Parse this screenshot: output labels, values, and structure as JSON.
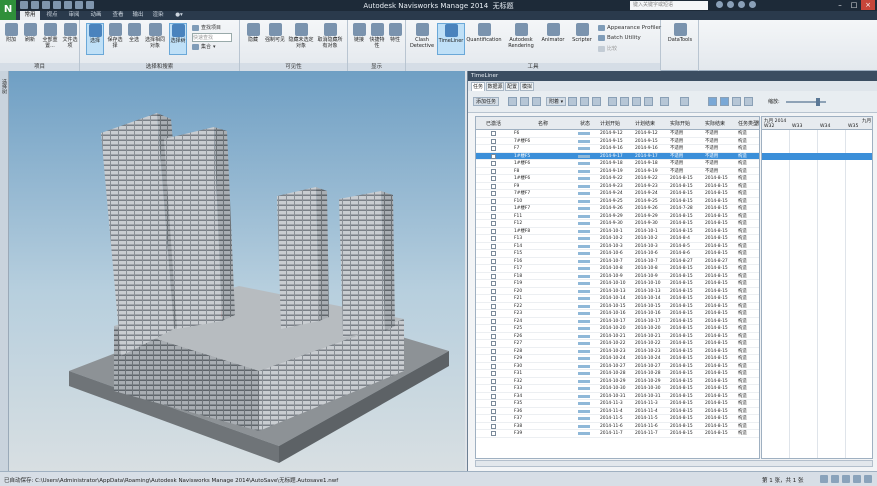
{
  "titlebar": {
    "app_title": "Autodesk Navisworks Manage 2014",
    "file_title": "无标题",
    "search_placeholder": "键入关键字或短语"
  },
  "ribbon_tabs": [
    "常用",
    "视点",
    "审阅",
    "动画",
    "查看",
    "输出",
    "渲染"
  ],
  "ribbon": {
    "project_group": {
      "label": "项目",
      "buttons": [
        "附加",
        "刷新",
        "全部重置...",
        "文件选项"
      ]
    },
    "select_group": {
      "label": "选择和搜索",
      "buttons": [
        "选择",
        "保存选择",
        "全选",
        "选择相同对象",
        "选择树"
      ],
      "small": [
        "查找项目",
        "快速查找",
        "集合"
      ]
    },
    "visibility_group": {
      "label": "可见性",
      "buttons": [
        "隐藏",
        "强制可见",
        "隐藏未选定对象",
        "取消隐藏所有对象"
      ]
    },
    "display_group": {
      "label": "显示",
      "buttons": [
        "链接",
        "快捷特性",
        "特性"
      ]
    },
    "tools_group": {
      "label": "工具",
      "buttons": [
        "Clash Detective",
        "TimeLiner",
        "Quantification",
        "Autodesk Rendering",
        "Animator",
        "Scripter"
      ],
      "small": [
        "Appearance Profiler",
        "Batch Utility",
        "比较"
      ]
    },
    "datatools_label": "DataTools"
  },
  "sidebar_label": "选择树",
  "timeliner": {
    "title": "TimeLiner",
    "tabs": [
      "任务",
      "数据源",
      "配置",
      "模拟"
    ],
    "toolbar": {
      "add_task": "添加任务",
      "attach": "附着",
      "zoom_label": "缩放:"
    },
    "columns": [
      "已激活",
      "名称",
      "状态",
      "计划开始",
      "计划结束",
      "实际开始",
      "实际结束",
      "任务类型",
      "附"
    ],
    "gantt": {
      "month": "九月 2014",
      "month_next": "九月",
      "weeks": [
        "W32",
        "W33",
        "W34",
        "W35"
      ]
    },
    "selected_row": 3,
    "tasks": [
      {
        "name": "F6",
        "ps": "2014-9-12",
        "pe": "2014-9-12",
        "as": "不适用",
        "ae": "不适用",
        "type": "构造"
      },
      {
        "name": "7#楼F6",
        "ps": "2014-9-15",
        "pe": "2014-9-15",
        "as": "不适用",
        "ae": "不适用",
        "type": "构造"
      },
      {
        "name": "F7",
        "ps": "2014-9-16",
        "pe": "2014-9-16",
        "as": "不适用",
        "ae": "不适用",
        "type": "构造"
      },
      {
        "name": "1#楼F5",
        "ps": "2014-9-17",
        "pe": "2014-9-17",
        "as": "不适用",
        "ae": "不适用",
        "type": "构造"
      },
      {
        "name": "1#楼F6",
        "ps": "2014-9-18",
        "pe": "2014-9-18",
        "as": "不适用",
        "ae": "不适用",
        "type": "构造"
      },
      {
        "name": "F8",
        "ps": "2014-9-19",
        "pe": "2014-9-19",
        "as": "不适用",
        "ae": "不适用",
        "type": "构造"
      },
      {
        "name": "1#楼F6",
        "ps": "2014-9-22",
        "pe": "2014-9-22",
        "as": "2014-8-15",
        "ae": "2014-8-15",
        "type": "构造"
      },
      {
        "name": "F9",
        "ps": "2014-9-23",
        "pe": "2014-9-23",
        "as": "2014-8-15",
        "ae": "2014-8-15",
        "type": "构造"
      },
      {
        "name": "7#楼F7",
        "ps": "2014-9-24",
        "pe": "2014-9-24",
        "as": "2014-8-15",
        "ae": "2014-8-15",
        "type": "构造"
      },
      {
        "name": "F10",
        "ps": "2014-9-25",
        "pe": "2014-9-25",
        "as": "2014-8-15",
        "ae": "2014-8-15",
        "type": "构造"
      },
      {
        "name": "1#楼F7",
        "ps": "2014-9-26",
        "pe": "2014-9-26",
        "as": "2014-7-28",
        "ae": "2014-8-15",
        "type": "构造"
      },
      {
        "name": "F11",
        "ps": "2014-9-29",
        "pe": "2014-9-29",
        "as": "2014-8-15",
        "ae": "2014-8-15",
        "type": "构造"
      },
      {
        "name": "F12",
        "ps": "2014-9-30",
        "pe": "2014-9-30",
        "as": "2014-8-15",
        "ae": "2014-8-15",
        "type": "构造"
      },
      {
        "name": "1#楼F8",
        "ps": "2014-10-1",
        "pe": "2014-10-1",
        "as": "2014-8-15",
        "ae": "2014-8-15",
        "type": "构造"
      },
      {
        "name": "F13",
        "ps": "2014-10-2",
        "pe": "2014-10-2",
        "as": "2014-8-4",
        "ae": "2014-8-15",
        "type": "构造"
      },
      {
        "name": "F14",
        "ps": "2014-10-3",
        "pe": "2014-10-3",
        "as": "2014-8-5",
        "ae": "2014-8-15",
        "type": "构造"
      },
      {
        "name": "F15",
        "ps": "2014-10-6",
        "pe": "2014-10-6",
        "as": "2014-8-6",
        "ae": "2014-8-15",
        "type": "构造"
      },
      {
        "name": "F16",
        "ps": "2014-10-7",
        "pe": "2014-10-7",
        "as": "2014-8-27",
        "ae": "2014-8-27",
        "type": "构造"
      },
      {
        "name": "F17",
        "ps": "2014-10-8",
        "pe": "2014-10-8",
        "as": "2014-8-15",
        "ae": "2014-8-15",
        "type": "构造"
      },
      {
        "name": "F18",
        "ps": "2014-10-9",
        "pe": "2014-10-9",
        "as": "2014-8-15",
        "ae": "2014-8-15",
        "type": "构造"
      },
      {
        "name": "F19",
        "ps": "2014-10-10",
        "pe": "2014-10-10",
        "as": "2014-8-15",
        "ae": "2014-8-15",
        "type": "构造"
      },
      {
        "name": "F20",
        "ps": "2014-10-13",
        "pe": "2014-10-13",
        "as": "2014-8-15",
        "ae": "2014-8-15",
        "type": "构造"
      },
      {
        "name": "F21",
        "ps": "2014-10-14",
        "pe": "2014-10-14",
        "as": "2014-8-15",
        "ae": "2014-8-15",
        "type": "构造"
      },
      {
        "name": "F22",
        "ps": "2014-10-15",
        "pe": "2014-10-15",
        "as": "2014-8-15",
        "ae": "2014-8-15",
        "type": "构造"
      },
      {
        "name": "F23",
        "ps": "2014-10-16",
        "pe": "2014-10-16",
        "as": "2014-8-15",
        "ae": "2014-8-15",
        "type": "构造"
      },
      {
        "name": "F24",
        "ps": "2014-10-17",
        "pe": "2014-10-17",
        "as": "2014-8-15",
        "ae": "2014-8-15",
        "type": "构造"
      },
      {
        "name": "F25",
        "ps": "2014-10-20",
        "pe": "2014-10-20",
        "as": "2014-8-15",
        "ae": "2014-8-15",
        "type": "构造"
      },
      {
        "name": "F26",
        "ps": "2014-10-21",
        "pe": "2014-10-21",
        "as": "2014-8-15",
        "ae": "2014-8-15",
        "type": "构造"
      },
      {
        "name": "F27",
        "ps": "2014-10-22",
        "pe": "2014-10-22",
        "as": "2014-8-15",
        "ae": "2014-8-15",
        "type": "构造"
      },
      {
        "name": "F28",
        "ps": "2014-10-23",
        "pe": "2014-10-23",
        "as": "2014-8-15",
        "ae": "2014-8-15",
        "type": "构造"
      },
      {
        "name": "F29",
        "ps": "2014-10-24",
        "pe": "2014-10-24",
        "as": "2014-8-15",
        "ae": "2014-8-15",
        "type": "构造"
      },
      {
        "name": "F30",
        "ps": "2014-10-27",
        "pe": "2014-10-27",
        "as": "2014-8-15",
        "ae": "2014-8-15",
        "type": "构造"
      },
      {
        "name": "F31",
        "ps": "2014-10-28",
        "pe": "2014-10-28",
        "as": "2014-8-15",
        "ae": "2014-8-15",
        "type": "构造"
      },
      {
        "name": "F32",
        "ps": "2014-10-29",
        "pe": "2014-10-29",
        "as": "2014-8-15",
        "ae": "2014-8-15",
        "type": "构造"
      },
      {
        "name": "F33",
        "ps": "2014-10-30",
        "pe": "2014-10-30",
        "as": "2014-8-15",
        "ae": "2014-8-15",
        "type": "构造"
      },
      {
        "name": "F34",
        "ps": "2014-10-31",
        "pe": "2014-10-31",
        "as": "2014-8-15",
        "ae": "2014-8-15",
        "type": "构造"
      },
      {
        "name": "F35",
        "ps": "2014-11-3",
        "pe": "2014-11-3",
        "as": "2014-8-15",
        "ae": "2014-8-15",
        "type": "构造"
      },
      {
        "name": "F36",
        "ps": "2014-11-4",
        "pe": "2014-11-4",
        "as": "2014-8-15",
        "ae": "2014-8-15",
        "type": "构造"
      },
      {
        "name": "F37",
        "ps": "2014-11-5",
        "pe": "2014-11-5",
        "as": "2014-8-15",
        "ae": "2014-8-15",
        "type": "构造"
      },
      {
        "name": "F38",
        "ps": "2014-11-6",
        "pe": "2014-11-6",
        "as": "2014-8-15",
        "ae": "2014-8-15",
        "type": "构造"
      },
      {
        "name": "F39",
        "ps": "2014-11-7",
        "pe": "2014-11-7",
        "as": "2014-8-15",
        "ae": "2014-8-15",
        "type": "构造"
      }
    ]
  },
  "statusbar": {
    "path": "已自动保存: C:\\Users\\Administrator\\AppData\\Roaming\\Autodesk Navisworks Manage 2014\\AutoSave\\无标题.Autosave1.nwf",
    "pages": "第 1 张，共 1 张"
  },
  "colors": {
    "accent": "#3b8fd9",
    "titlebar": "#1d2a38",
    "app_button": "#2f8f3a"
  }
}
